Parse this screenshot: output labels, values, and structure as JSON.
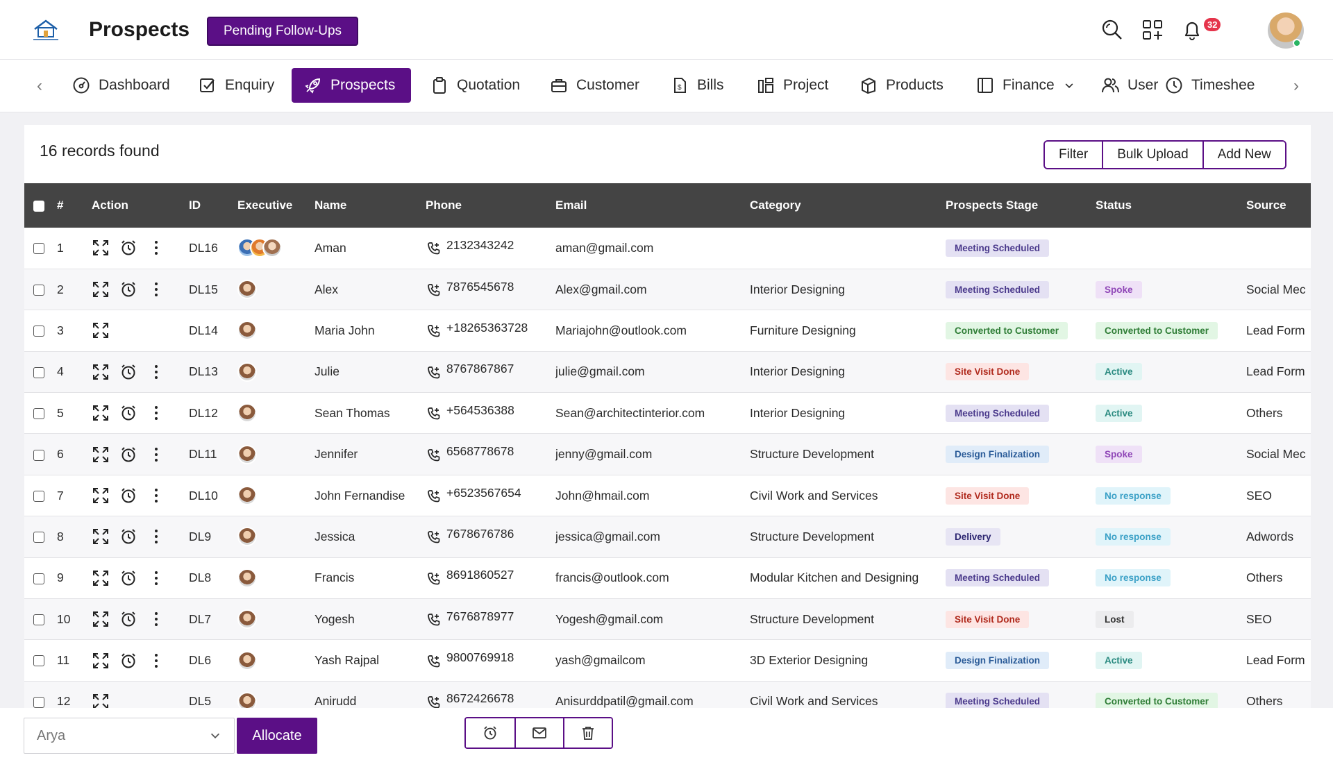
{
  "header": {
    "title": "Prospects",
    "pending_button": "Pending Follow-Ups",
    "notification_count": "32"
  },
  "nav": {
    "items": [
      {
        "label": "Dashboard",
        "icon": "dashboard-icon"
      },
      {
        "label": "Enquiry",
        "icon": "enquiry-icon"
      },
      {
        "label": "Prospects",
        "icon": "rocket-icon",
        "active": true
      },
      {
        "label": "Quotation",
        "icon": "clipboard-icon"
      },
      {
        "label": "Customer",
        "icon": "briefcase-icon"
      },
      {
        "label": "Bills",
        "icon": "bill-icon"
      },
      {
        "label": "Project",
        "icon": "project-icon"
      },
      {
        "label": "Products",
        "icon": "products-icon"
      },
      {
        "label": "Finance",
        "icon": "finance-icon"
      },
      {
        "label": "User",
        "icon": "users-icon"
      },
      {
        "label": "Timeshee",
        "icon": "clock-icon"
      }
    ]
  },
  "toolbar": {
    "records_text": "16 records found",
    "filter": "Filter",
    "bulk_upload": "Bulk Upload",
    "add_new": "Add New"
  },
  "table": {
    "columns": [
      "#",
      "Action",
      "ID",
      "Executive",
      "Name",
      "Phone",
      "Email",
      "Category",
      "Prospects Stage",
      "Status",
      "Source"
    ],
    "rows": [
      {
        "num": "1",
        "id": "DL16",
        "name": "Aman",
        "phone": "2132343242",
        "email": "aman@gmail.com",
        "category": "",
        "stage": "Meeting Scheduled",
        "status": "",
        "source": ""
      },
      {
        "num": "2",
        "id": "DL15",
        "name": "Alex",
        "phone": "7876545678",
        "email": "Alex@gmail.com",
        "category": "Interior Designing",
        "stage": "Meeting Scheduled",
        "status": "Spoke",
        "source": "Social Mec"
      },
      {
        "num": "3",
        "id": "DL14",
        "name": "Maria John",
        "phone": "+18265363728",
        "email": "Mariajohn@outlook.com",
        "category": "Furniture Designing",
        "stage": "Converted to Customer",
        "status": "Converted to Customer",
        "source": "Lead Form"
      },
      {
        "num": "4",
        "id": "DL13",
        "name": "Julie",
        "phone": "8767867867",
        "email": "julie@gmail.com",
        "category": "Interior Designing",
        "stage": "Site Visit Done",
        "status": "Active",
        "source": "Lead Form"
      },
      {
        "num": "5",
        "id": "DL12",
        "name": "Sean Thomas",
        "phone": "+564536388",
        "email": "Sean@architectinterior.com",
        "category": "Interior Designing",
        "stage": "Meeting Scheduled",
        "status": "Active",
        "source": "Others"
      },
      {
        "num": "6",
        "id": "DL11",
        "name": "Jennifer",
        "phone": "6568778678",
        "email": "jenny@gmail.com",
        "category": "Structure Development",
        "stage": "Design Finalization",
        "status": "Spoke",
        "source": "Social Mec"
      },
      {
        "num": "7",
        "id": "DL10",
        "name": "John Fernandise",
        "phone": "+6523567654",
        "email": "John@hmail.com",
        "category": "Civil Work and Services",
        "stage": "Site Visit Done",
        "status": "No response",
        "source": "SEO"
      },
      {
        "num": "8",
        "id": "DL9",
        "name": "Jessica",
        "phone": "7678676786",
        "email": "jessica@gmail.com",
        "category": "Structure Development",
        "stage": "Delivery",
        "status": "No response",
        "source": "Adwords"
      },
      {
        "num": "9",
        "id": "DL8",
        "name": "Francis",
        "phone": "8691860527",
        "email": "francis@outlook.com",
        "category": "Modular Kitchen and Designing",
        "stage": "Meeting Scheduled",
        "status": "No response",
        "source": "Others"
      },
      {
        "num": "10",
        "id": "DL7",
        "name": "Yogesh",
        "phone": "7676878977",
        "email": "Yogesh@gmail.com",
        "category": "Structure Development",
        "stage": "Site Visit Done",
        "status": "Lost",
        "source": "SEO"
      },
      {
        "num": "11",
        "id": "DL6",
        "name": "Yash Rajpal",
        "phone": "9800769918",
        "email": "yash@gmailcom",
        "category": "3D Exterior Designing",
        "stage": "Design Finalization",
        "status": "Active",
        "source": "Lead Form"
      },
      {
        "num": "12",
        "id": "DL5",
        "name": "Anirudd",
        "phone": "8672426678",
        "email": "Anisurddpatil@gmail.com",
        "category": "Civil Work and Services",
        "stage": "Meeting Scheduled",
        "status": "Converted to Customer",
        "source": "Others"
      }
    ]
  },
  "bottom": {
    "select_value": "Arya",
    "allocate": "Allocate"
  },
  "colors": {
    "accent": "#5b0f86",
    "table_header": "#444444"
  }
}
